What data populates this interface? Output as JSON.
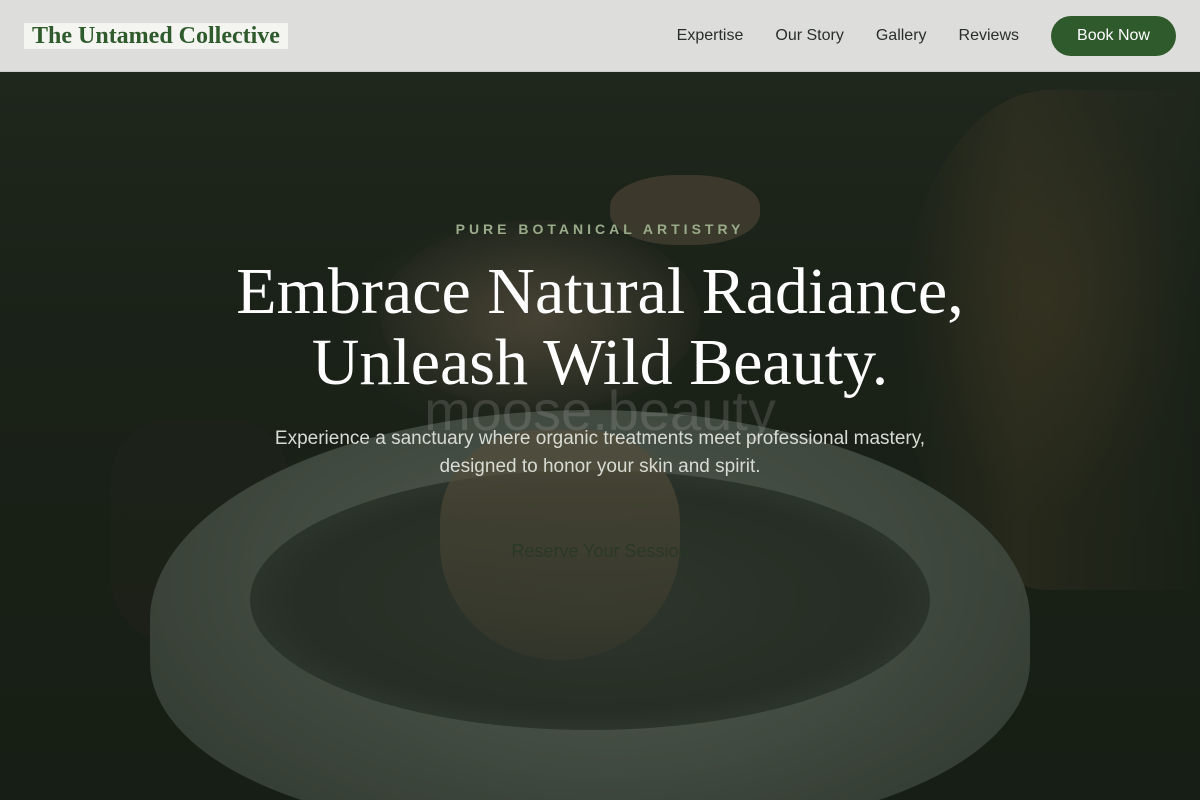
{
  "header": {
    "brand": "The Untamed Collective",
    "nav": [
      {
        "label": "Expertise"
      },
      {
        "label": "Our Story"
      },
      {
        "label": "Gallery"
      },
      {
        "label": "Reviews"
      }
    ],
    "book_label": "Book Now"
  },
  "hero": {
    "eyebrow": "PURE BOTANICAL ARTISTRY",
    "headline_line1": "Embrace Natural Radiance,",
    "headline_line2": "Unleash Wild Beauty.",
    "watermark": "moose.beauty",
    "subtitle": "Experience a sanctuary where organic treatments meet professional mastery, designed to honor your skin and spirit.",
    "cta_label": "Reserve Your Session"
  },
  "colors": {
    "brand_green": "#2f5a2c",
    "eyebrow": "#9aab8a",
    "header_bg": "#ecedea"
  }
}
